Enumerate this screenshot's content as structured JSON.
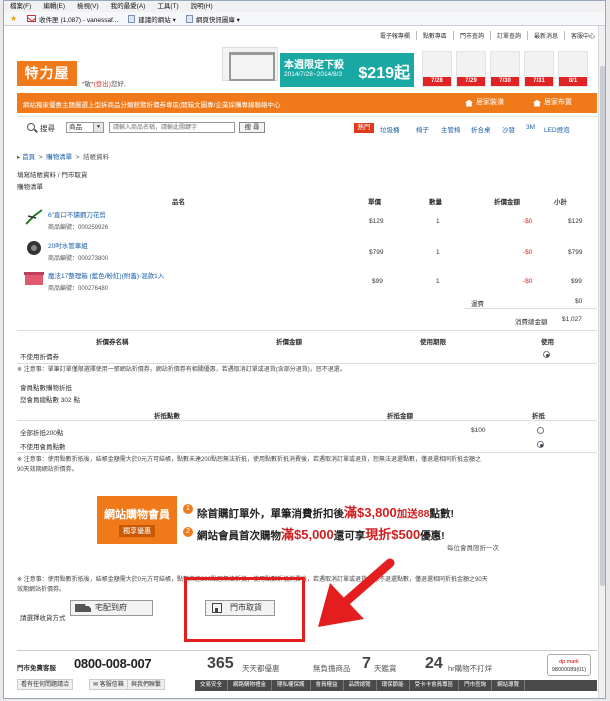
{
  "browser": {
    "menu": [
      "檔案(F)",
      "編輯(E)",
      "檢視(V)",
      "我的最愛(A)",
      "工具(T)",
      "說明(H)"
    ],
    "favorites": [
      "收件匣 (1,087) - vanessaf...",
      "建議的網站 ▾",
      "網頁快訊圖庫 ▾"
    ]
  },
  "site": {
    "toplinks": [
      "電子報專欄",
      "點數專區",
      "門市查詢",
      "訂單查詢",
      "最新消息",
      "客服中心"
    ],
    "logo": "特力屋",
    "greeting_prefix": "您好, ",
    "greeting_name": "*敏*",
    "greeting_logout": "(登出)",
    "promo_title": "本週限定下殺",
    "promo_dates": "2014/7/28~2014/8/3",
    "promo_price": "$219起",
    "product_tags": [
      "7/28",
      "7/29",
      "7/30",
      "7/31",
      "8/1"
    ],
    "announcement": "網站獨家優惠主題嚴選上型拆商品分類館覽折價券專區(開箱文圖專/企業採購專線聯絡中心",
    "tab_home": "居家裝潢",
    "tab_hola": "居家布置"
  },
  "search": {
    "label": "搜尋",
    "category": "商品",
    "placeholder": "請輸入商品名稱，請輸此關鍵字",
    "button": "搜 尋",
    "hot": "熱門",
    "keywords": [
      "垃圾桶",
      "椅子",
      "主管椅",
      "折合桌",
      "沙發",
      "3M",
      "LED燈泡"
    ]
  },
  "page": {
    "breadcrumb": [
      "首頁",
      "購物清單",
      "結帳資料"
    ],
    "step": "填寫結帳資料 / 門市取貨",
    "cart_label": "購物清單",
    "headers": [
      "品名",
      "單價",
      "數量",
      "折價金額",
      "小計"
    ],
    "items": [
      {
        "name": "6\"直口不鏽鋼刀花剪",
        "code": "商品編號：000259926",
        "price": "$129",
        "qty": "1",
        "discount": "-$0",
        "subtotal": "$129"
      },
      {
        "name": "20吋水管車組",
        "code": "商品編號：000273800",
        "price": "$799",
        "qty": "1",
        "discount": "-$0",
        "subtotal": "$799"
      },
      {
        "name": "魔法17整理箱 (藍色/粉紅)(附蓋)-混款1入",
        "code": "商品編號：000276480",
        "price": "$99",
        "qty": "1",
        "discount": "-$0",
        "subtotal": "$99"
      }
    ],
    "shipping_label": "運費",
    "shipping_value": "$0",
    "total_label": "消費總金額",
    "total_value": "$1,027"
  },
  "coupon": {
    "headers": [
      "折價券名稱",
      "折價金額",
      "使用期限",
      "使用"
    ],
    "none_label": "不使用折價券",
    "note": "※ 注意事：單筆訂單僅限選擇使用一張網站折價券，網站折價券有相關優惠，若遇取消訂單或退貨(含部分退貨)，恕不退還。"
  },
  "points": {
    "title": "會員點數購物折抵",
    "balance": "您會員總點數 302 點",
    "headers": [
      "折抵點數",
      "折抵金額",
      "折抵"
    ],
    "opt_all": "全部折抵200點",
    "opt_all_value": "$100",
    "opt_none": "不使用會員點數",
    "note1": "※ 注意事：使用點數折抵後，結帳金額需大於0元方可結帳，點數未達200點恕無法折抵，使用點數折抵消費後，若遇取消訂單或退貨，恕無法退還點數，僅退還相同折抵金額之",
    "note2": "90天效期網站折價券。"
  },
  "banner": {
    "left1": "網站購物會員",
    "left2": "獨享優惠",
    "line1a": "除首購訂單外，單筆消費折扣後",
    "line1b": "滿$3,800",
    "line1c": "加送88",
    "line1d": "點數!",
    "line2a": "網站會員首次購物",
    "line2b": "滿$5,000",
    "line2c": "還可享",
    "line2d": "現折$500",
    "line2e": "優惠!",
    "small": "每位會員限折一次"
  },
  "delivery": {
    "note1": "※ 注意事：使用點數折抵後，結帳金額需大於0元方可結帳，點數未達200點恕無法折抵，使用點數折抵消費後，若遇取消訂單或退貨，恕不退還點數，僅退還相同折抵金額之90天",
    "note2": "效期網站折價券。",
    "label": "請選擇收貨方式",
    "home": "宅配到府",
    "store": "門市取貨"
  },
  "footer": {
    "hotline_label": "門市免費客服",
    "hotline": "0800-008-007",
    "btn1": "看有任何問題請洽",
    "btn2": "客服信箱",
    "btn3": "與我們聯繫",
    "s1_big": "365",
    "s1_small": "天天都優惠",
    "s2_small_a": "無負擔商品",
    "s2_big": "7",
    "s2_small_b": "天鑑賞",
    "s3_big": "24",
    "s3_small": "hr購物不打烊",
    "links": [
      "交易安全",
      "網路購物禮金",
      "隱私權保護",
      "會員權益",
      "品牌總覽",
      "環保節能",
      "受卡卡會員專區",
      "門市查詢",
      "網站導覽"
    ],
    "badge1": "dp.mark",
    "badge2": "98000089(01)"
  }
}
